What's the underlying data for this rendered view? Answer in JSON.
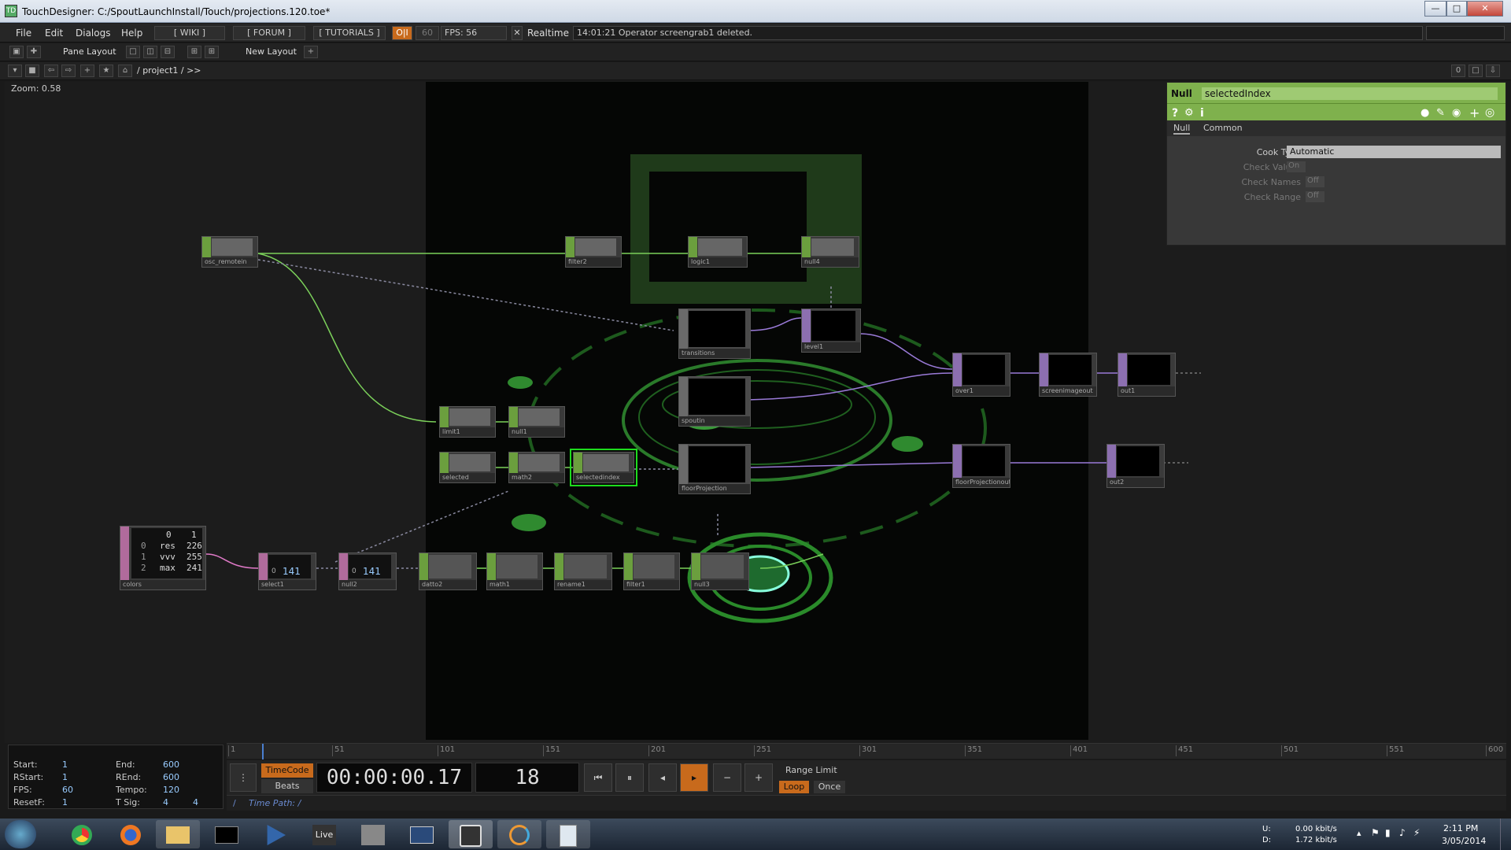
{
  "window": {
    "title": "TouchDesigner: C:/SpoutLaunchInstall/Touch/projections.120.toe*"
  },
  "menu": {
    "file": "File",
    "edit": "Edit",
    "dialogs": "Dialogs",
    "help": "Help",
    "wiki": "[ WIKI ]",
    "forum": "[ FORUM ]",
    "tutorials": "[ TUTORIALS ]",
    "oi": "O|I",
    "fps_cap": "60",
    "fps": "FPS:  56",
    "realtime": "Realtime",
    "message": "14:01:21 Operator screengrab1 deleted."
  },
  "toolbar": {
    "pane_layout": "Pane Layout",
    "new_layout": "New Layout",
    "path": "/ project1 / >>",
    "counter": "0"
  },
  "network": {
    "zoom": "Zoom: 0.58"
  },
  "nodes": [
    {
      "label": "osc_remotein",
      "type": "chop"
    },
    {
      "label": "filter2",
      "type": "chop"
    },
    {
      "label": "logic1",
      "type": "chop"
    },
    {
      "label": "null4",
      "type": "chop"
    },
    {
      "label": "transitions",
      "type": "top"
    },
    {
      "label": "level1",
      "type": "top"
    },
    {
      "label": "over1",
      "type": "top"
    },
    {
      "label": "screenimageout",
      "type": "top"
    },
    {
      "label": "out1",
      "type": "top"
    },
    {
      "label": "spoutin",
      "type": "top"
    },
    {
      "label": "limit1",
      "type": "chop"
    },
    {
      "label": "null1",
      "type": "chop"
    },
    {
      "label": "selected",
      "type": "chop"
    },
    {
      "label": "math2",
      "type": "chop"
    },
    {
      "label": "selectedindex",
      "type": "chop"
    },
    {
      "label": "floorProjection",
      "type": "top"
    },
    {
      "label": "floorProjectionout",
      "type": "top"
    },
    {
      "label": "out2",
      "type": "top"
    },
    {
      "label": "colors",
      "type": "dat"
    },
    {
      "label": "select1",
      "type": "dat"
    },
    {
      "label": "null2",
      "type": "dat"
    },
    {
      "label": "datto2",
      "type": "chop"
    },
    {
      "label": "math1",
      "type": "chop"
    },
    {
      "label": "rename1",
      "type": "chop"
    },
    {
      "label": "filter1",
      "type": "chop"
    },
    {
      "label": "null3",
      "type": "chop"
    }
  ],
  "colors_table": {
    "header": [
      "0",
      "1"
    ],
    "rows": [
      [
        "0",
        "res",
        "226"
      ],
      [
        "1",
        "vvv",
        "255"
      ],
      [
        "2",
        "max",
        "241"
      ]
    ]
  },
  "node_values": {
    "select1": "141",
    "null2": "141",
    "select1_idx": "0",
    "null2_idx": "0"
  },
  "panel": {
    "type": "Null",
    "name": "selectedIndex",
    "tab_null": "Null",
    "tab_common": "Common",
    "params": [
      {
        "label": "Cook Type",
        "value": "Automatic"
      },
      {
        "label": "Check Values",
        "value": "On"
      },
      {
        "label": "Check Names",
        "value": "Off"
      },
      {
        "label": "Check Range",
        "value": "Off"
      }
    ]
  },
  "timeline": {
    "ticks": [
      "1",
      "51",
      "101",
      "151",
      "201",
      "251",
      "301",
      "351",
      "401",
      "451",
      "501",
      "551",
      "600"
    ]
  },
  "stats": {
    "start_l": "Start:",
    "start": "1",
    "end_l": "End:",
    "end": "600",
    "rstart_l": "RStart:",
    "rstart": "1",
    "rend_l": "REnd:",
    "rend": "600",
    "fps_l": "FPS:",
    "fps": "60",
    "tempo_l": "Tempo:",
    "tempo": "120",
    "resetf_l": "ResetF:",
    "resetf": "1",
    "tsig_l": "T Sig:",
    "tsig1": "4",
    "tsig2": "4"
  },
  "transport": {
    "timecode_btn": "TimeCode",
    "beats_btn": "Beats",
    "timecode": "00:00:00.17",
    "frame": "18",
    "range_limit": "Range Limit",
    "loop": "Loop",
    "once": "Once",
    "timepath": "Time Path: /"
  },
  "taskbar": {
    "live": "Live",
    "net_up_l": "U:",
    "net_up": "0.00 kbit/s",
    "net_down_l": "D:",
    "net_down": "1.72 kbit/s",
    "time": "2:11 PM",
    "date": "3/05/2014"
  },
  "colors": {
    "chop": "#6b9f3e",
    "top": "#8c6fb0",
    "dat": "#b06b9c",
    "panel_head": "#7fb14d",
    "accent": "#e07a20",
    "select": "#1edc1e"
  }
}
